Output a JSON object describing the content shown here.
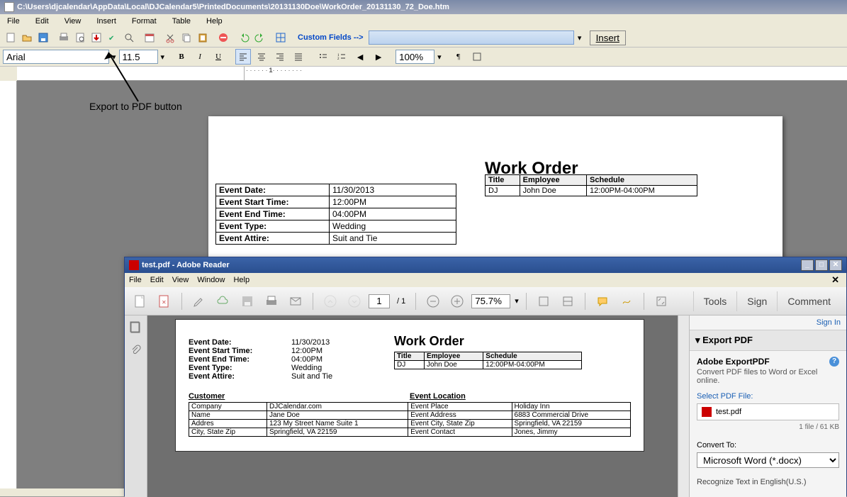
{
  "editor": {
    "title": "C:\\Users\\djcalendar\\AppData\\Local\\DJCalendar5\\PrintedDocuments\\20131130Doe\\WorkOrder_20131130_72_Doe.htm",
    "menu": [
      "File",
      "Edit",
      "View",
      "Insert",
      "Format",
      "Table",
      "Help"
    ],
    "custom_fields_label": "Custom Fields -->",
    "insert_btn": "Insert",
    "font": "Arial",
    "font_size": "11.5",
    "zoom": "100%"
  },
  "annotation": "Export to PDF button",
  "document": {
    "title": "Work Order",
    "events": [
      {
        "label": "Event Date:",
        "value": "11/30/2013"
      },
      {
        "label": "Event Start Time:",
        "value": "12:00PM"
      },
      {
        "label": "Event End Time:",
        "value": "04:00PM"
      },
      {
        "label": "Event Type:",
        "value": "Wedding"
      },
      {
        "label": "Event Attire:",
        "value": "Suit and Tie"
      }
    ],
    "emp_headers": [
      "Title",
      "Employee",
      "Schedule"
    ],
    "emp_row": [
      "DJ",
      "John Doe",
      "12:00PM-04:00PM"
    ]
  },
  "reader": {
    "title": "test.pdf - Adobe Reader",
    "menu": [
      "File",
      "Edit",
      "View",
      "Window",
      "Help"
    ],
    "page_current": "1",
    "page_total": "/ 1",
    "zoom": "75.7%",
    "right_tabs": [
      "Tools",
      "Sign",
      "Comment"
    ],
    "sign_in": "Sign In",
    "panel": {
      "head": "Export PDF",
      "title": "Adobe ExportPDF",
      "sub": "Convert PDF files to Word or Excel online.",
      "select_label": "Select PDF File:",
      "file": "test.pdf",
      "meta": "1 file / 61 KB",
      "convert_label": "Convert To:",
      "convert_value": "Microsoft Word (*.docx)",
      "recognize": "Recognize Text in English(U.S.)"
    },
    "doc": {
      "title": "Work Order",
      "emp_headers": [
        "Title",
        "Employee",
        "Schedule"
      ],
      "emp_row": [
        "DJ",
        "John Doe",
        "12:00PM-04:00PM"
      ],
      "events": [
        {
          "label": "Event Date:",
          "value": "11/30/2013"
        },
        {
          "label": "Event Start Time:",
          "value": "12:00PM"
        },
        {
          "label": "Event End Time:",
          "value": "04:00PM"
        },
        {
          "label": "Event Type:",
          "value": "Wedding"
        },
        {
          "label": "Event Attire:",
          "value": "Suit and Tie"
        }
      ],
      "customer_head": "Customer",
      "location_head": "Event Location",
      "cust_rows": [
        [
          "Company",
          "DJCalendar.com",
          "Event Place",
          "Holiday Inn"
        ],
        [
          "Name",
          "Jane Doe",
          "Event Address",
          "6883 Commercial Drive"
        ],
        [
          "Addres",
          "123 My Street Name Suite 1",
          "Event City, State Zip",
          "Springfield, VA 22159"
        ],
        [
          "City, State Zip",
          "Springfield, VA 22159",
          "Event Contact",
          "Jones, Jimmy"
        ]
      ]
    }
  }
}
